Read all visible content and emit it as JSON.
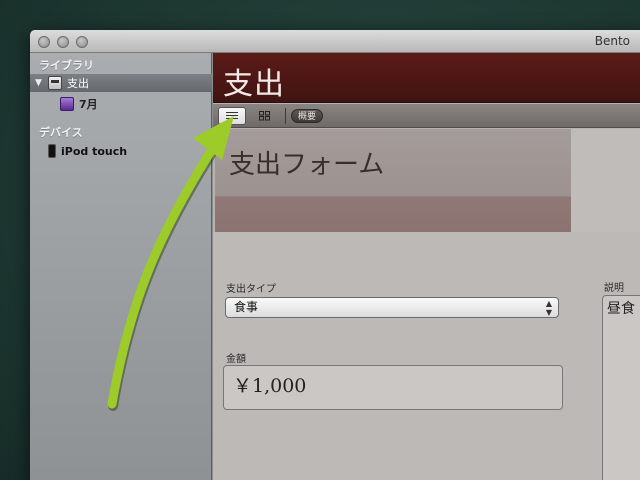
{
  "window": {
    "title": "Bento"
  },
  "sidebar": {
    "library_header": "ライブラリ",
    "items": [
      {
        "label": "支出",
        "icon": "register-icon"
      },
      {
        "label": "7月",
        "icon": "collection-icon"
      }
    ],
    "devices_header": "デバイス",
    "devices": [
      {
        "label": "iPod touch",
        "icon": "ipod-icon"
      }
    ]
  },
  "header": {
    "title": "支出"
  },
  "toolbar": {
    "summary_label": "概要"
  },
  "form": {
    "title": "支出フォーム",
    "expense_type_label": "支出タイプ",
    "expense_type_value": "食事",
    "amount_label": "金額",
    "amount_value": "￥1,000",
    "description_label": "説明",
    "description_value": "昼食"
  },
  "annotation": {
    "arrow_color": "#9ccb2a"
  }
}
